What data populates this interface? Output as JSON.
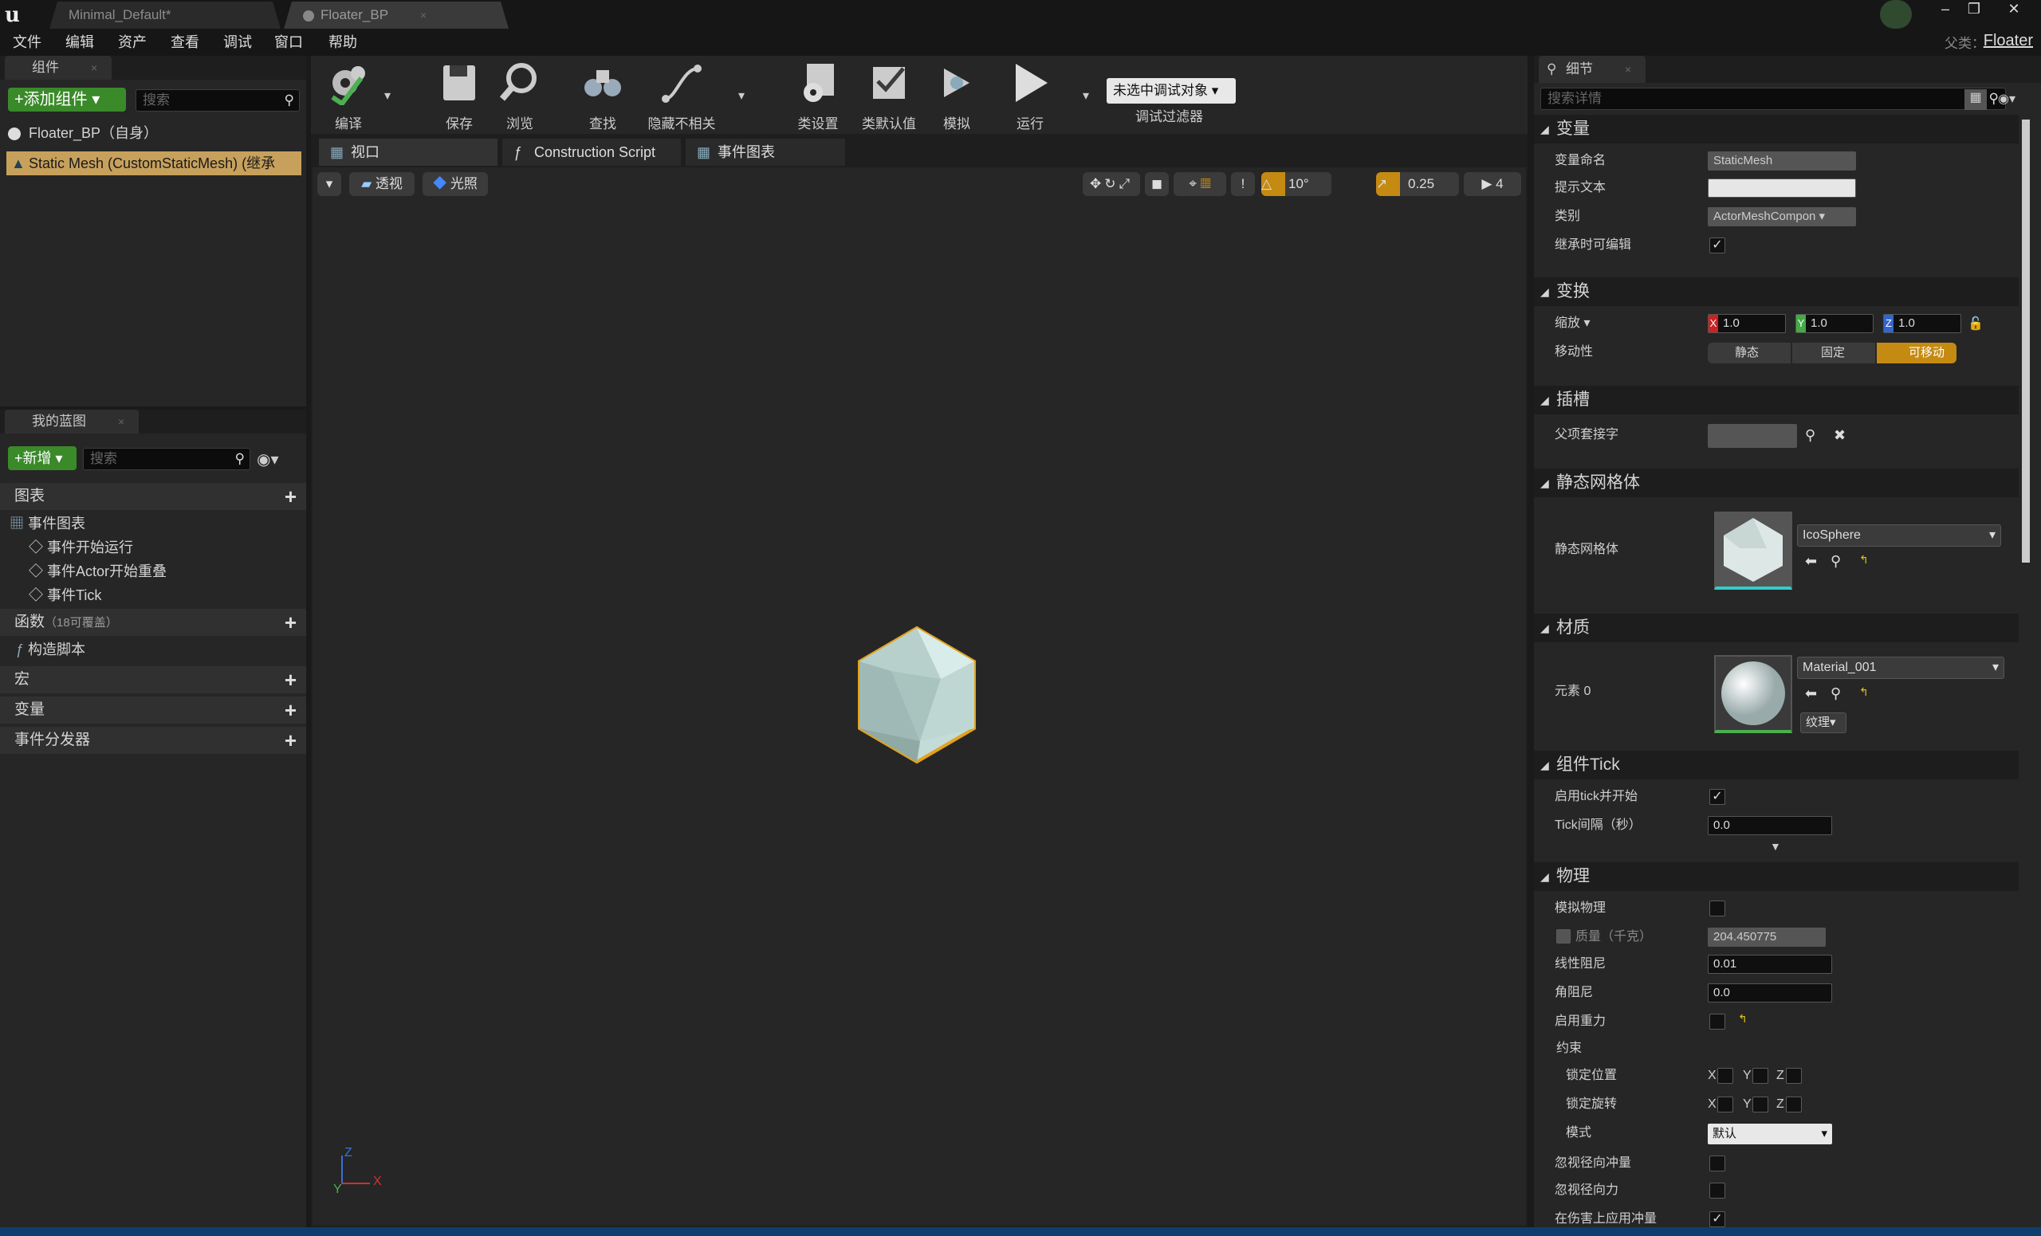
{
  "title_bar": {
    "tabs": [
      {
        "label": "Minimal_Default*",
        "close": "×"
      },
      {
        "label": "Floater_BP",
        "close": "×"
      }
    ],
    "parent_label": "父类：",
    "parent_value": "Floater"
  },
  "menu": [
    "文件",
    "编辑",
    "资产",
    "查看",
    "调试",
    "窗口",
    "帮助"
  ],
  "components_panel": {
    "tab": "组件",
    "add_button": "+添加组件",
    "search_placeholder": "搜索",
    "root_item": "Floater_BP（自身）",
    "selected_item": "Static Mesh (CustomStaticMesh) (继承"
  },
  "my_blueprint": {
    "tab": "我的蓝图",
    "new_button": "+新增",
    "search_placeholder": "搜索",
    "sections": {
      "graphs": "图表",
      "event_graph": "事件图表",
      "events": [
        "事件开始运行",
        "事件Actor开始重叠",
        "事件Tick"
      ],
      "functions": "函数",
      "functions_count": "（18可覆盖）",
      "construction": "构造脚本",
      "macros": "宏",
      "variables": "变量",
      "dispatchers": "事件分发器"
    }
  },
  "toolbar": {
    "compile": "编译",
    "save": "保存",
    "browse": "浏览",
    "find": "查找",
    "hide_unrelated": "隐藏不相关",
    "class_settings": "类设置",
    "class_defaults": "类默认值",
    "simulate": "模拟",
    "play": "运行",
    "debug_object": "未选中调试对象",
    "debug_filter": "调试过滤器"
  },
  "editor_tabs": [
    "视口",
    "Construction Script",
    "事件图表"
  ],
  "viewport": {
    "perspective": "透视",
    "lit": "光照",
    "rotation_snap": "10°",
    "scale_snap": "0.25",
    "camera_speed": "4",
    "axis_x": "X",
    "axis_y": "Y",
    "axis_z": "Z"
  },
  "details": {
    "tab": "细节",
    "search_placeholder": "搜索详情",
    "variable": {
      "section": "变量",
      "name_label": "变量命名",
      "name_value": "StaticMesh",
      "tooltip_label": "提示文本",
      "tooltip_value": "",
      "category_label": "类别",
      "category_value": "ActorMeshCompon",
      "editable_label": "继承时可编辑"
    },
    "transform": {
      "section": "变换",
      "scale_label": "缩放 ▾",
      "x": "1.0",
      "y": "1.0",
      "z": "1.0",
      "mobility_label": "移动性",
      "mobility": [
        "静态",
        "固定",
        "可移动"
      ]
    },
    "sockets": {
      "section": "插槽",
      "parent_socket_label": "父项套接字"
    },
    "static_mesh": {
      "section": "静态网格体",
      "label": "静态网格体",
      "value": "IcoSphere"
    },
    "materials": {
      "section": "材质",
      "element_label": "元素 0",
      "value": "Material_001",
      "texture_btn": "纹理"
    },
    "component_tick": {
      "section": "组件Tick",
      "start_label": "启用tick并开始",
      "interval_label": "Tick间隔（秒）",
      "interval_value": "0.0"
    },
    "physics": {
      "section": "物理",
      "simulate_label": "模拟物理",
      "mass_label": "质量（千克）",
      "mass_value": "204.450775",
      "linear_damping_label": "线性阻尼",
      "linear_damping_value": "0.01",
      "angular_damping_label": "角阻尼",
      "angular_damping_value": "0.0",
      "gravity_label": "启用重力",
      "constraints_label": "约束",
      "lock_pos_label": "锁定位置",
      "lock_rot_label": "锁定旋转",
      "mode_label": "模式",
      "mode_value": "默认",
      "ignore_radial_impulse": "忽视径向冲量",
      "ignore_radial_force": "忽视径向力",
      "apply_impulse_damage": "在伤害上应用冲量",
      "x": "X",
      "y": "Y",
      "z": "Z"
    }
  }
}
